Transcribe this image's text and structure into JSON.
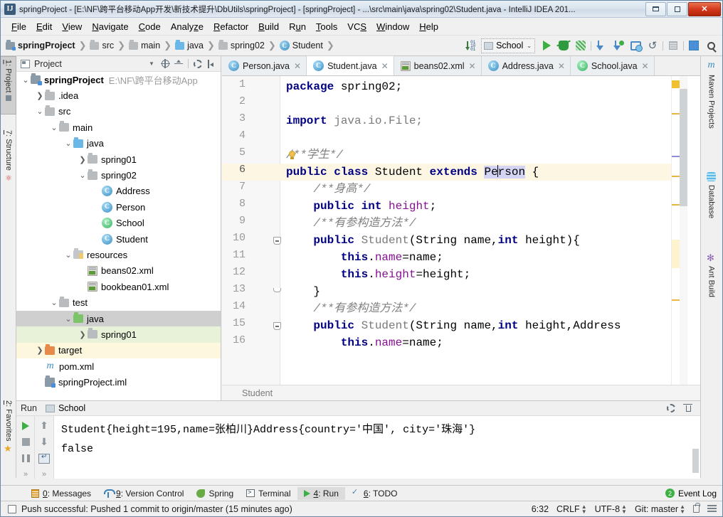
{
  "window": {
    "app_icon": "IJ",
    "title": "springProject - [E:\\NF\\跨平台移动App开发\\新技术提升\\DbUtils\\springProject] - [springProject] - ...\\src\\main\\java\\spring02\\Student.java - IntelliJ IDEA 201...",
    "buttons": {
      "minimize": "minimize-button",
      "maximize": "maximize-button",
      "close": "✕"
    }
  },
  "menubar": {
    "items": [
      {
        "label": "File"
      },
      {
        "label": "Edit"
      },
      {
        "label": "View"
      },
      {
        "label": "Navigate"
      },
      {
        "label": "Code"
      },
      {
        "label": "Analyze"
      },
      {
        "label": "Refactor"
      },
      {
        "label": "Build"
      },
      {
        "label": "Run"
      },
      {
        "label": "Tools"
      },
      {
        "label": "VCS"
      },
      {
        "label": "Window"
      },
      {
        "label": "Help"
      }
    ]
  },
  "navbar": {
    "breadcrumbs": [
      {
        "label": "springProject",
        "icon": "module-icon"
      },
      {
        "label": "src",
        "icon": "folder-icon"
      },
      {
        "label": "main",
        "icon": "folder-icon"
      },
      {
        "label": "java",
        "icon": "source-folder-icon"
      },
      {
        "label": "spring02",
        "icon": "package-icon"
      },
      {
        "label": "Student",
        "icon": "class-icon"
      }
    ],
    "separator": "❯",
    "run_config": "School",
    "run_config_caret": "⌄",
    "toolbar": [
      {
        "name": "sort-by-order-icon",
        "title": "Sort"
      },
      {
        "name": "run-icon",
        "title": "Run"
      },
      {
        "name": "debug-icon",
        "title": "Debug"
      },
      {
        "name": "run-coverage-icon",
        "title": "Run with Coverage"
      },
      {
        "name": "update-project-icon",
        "title": "Update Project"
      },
      {
        "name": "commit-icon",
        "title": "Commit"
      },
      {
        "name": "history-icon",
        "title": "History"
      },
      {
        "name": "rollback-icon",
        "title": "Rollback"
      },
      {
        "name": "settings-stripe-icon",
        "title": "Stripe"
      },
      {
        "name": "structure-icon",
        "title": "Structure"
      },
      {
        "name": "search-everywhere-icon",
        "title": "Search Everywhere"
      }
    ]
  },
  "left_strip": {
    "tabs": [
      {
        "label": "1: Project",
        "num": "1",
        "selected": true,
        "icon": "project-icon"
      },
      {
        "label": "7: Structure",
        "num": "7",
        "selected": false,
        "icon": "structure-icon"
      },
      {
        "label": "2: Favorites",
        "num": "2",
        "selected": false,
        "icon": "star-icon"
      }
    ]
  },
  "project_panel": {
    "title": "Project",
    "tools": [
      {
        "name": "view-options-caret-icon"
      },
      {
        "name": "scroll-to-source-icon"
      },
      {
        "name": "collapse-all-icon"
      },
      {
        "name": "gear-icon"
      },
      {
        "name": "hide-panel-icon"
      }
    ],
    "tree": [
      {
        "indent": 0,
        "chev": "⌄",
        "icon": "module-icon",
        "label": "springProject",
        "bold": true,
        "sub": "E:\\NF\\跨平台移动App",
        "highlight": ""
      },
      {
        "indent": 1,
        "chev": "❯",
        "icon": "folder-icon",
        "label": ".idea",
        "highlight": ""
      },
      {
        "indent": 1,
        "chev": "⌄",
        "icon": "folder-icon",
        "label": "src",
        "highlight": ""
      },
      {
        "indent": 2,
        "chev": "⌄",
        "icon": "folder-icon",
        "label": "main",
        "highlight": ""
      },
      {
        "indent": 3,
        "chev": "⌄",
        "icon": "source-folder-icon",
        "label": "java",
        "highlight": ""
      },
      {
        "indent": 4,
        "chev": "❯",
        "icon": "package-icon",
        "label": "spring01",
        "highlight": ""
      },
      {
        "indent": 4,
        "chev": "⌄",
        "icon": "package-icon",
        "label": "spring02",
        "highlight": ""
      },
      {
        "indent": 5,
        "chev": "",
        "icon": "class-icon",
        "label": "Address",
        "highlight": ""
      },
      {
        "indent": 5,
        "chev": "",
        "icon": "class-icon",
        "label": "Person",
        "highlight": ""
      },
      {
        "indent": 5,
        "chev": "",
        "icon": "class-icon-green",
        "label": "School",
        "highlight": ""
      },
      {
        "indent": 5,
        "chev": "",
        "icon": "class-icon",
        "label": "Student",
        "highlight": ""
      },
      {
        "indent": 3,
        "chev": "⌄",
        "icon": "resources-folder-icon",
        "label": "resources",
        "highlight": ""
      },
      {
        "indent": 4,
        "chev": "",
        "icon": "xml-file-icon",
        "label": "beans02.xml",
        "highlight": ""
      },
      {
        "indent": 4,
        "chev": "",
        "icon": "xml-file-icon",
        "label": "bookbean01.xml",
        "highlight": ""
      },
      {
        "indent": 2,
        "chev": "⌄",
        "icon": "folder-icon",
        "label": "test",
        "highlight": ""
      },
      {
        "indent": 3,
        "chev": "⌄",
        "icon": "test-source-folder-icon",
        "label": "java",
        "highlight": "gray"
      },
      {
        "indent": 4,
        "chev": "❯",
        "icon": "package-icon",
        "label": "spring01",
        "highlight": "green"
      },
      {
        "indent": 1,
        "chev": "❯",
        "icon": "target-folder-icon",
        "label": "target",
        "highlight": "yellow"
      },
      {
        "indent": 1,
        "chev": "",
        "icon": "maven-file-icon",
        "label": "pom.xml",
        "highlight": ""
      },
      {
        "indent": 1,
        "chev": "",
        "icon": "iml-file-icon",
        "label": "springProject.iml",
        "highlight": ""
      }
    ]
  },
  "editor": {
    "tabs": [
      {
        "label": "Person.java",
        "icon": "class-icon",
        "active": false,
        "close": "✕"
      },
      {
        "label": "Student.java",
        "icon": "class-icon",
        "active": true,
        "close": "✕"
      },
      {
        "label": "beans02.xml",
        "icon": "xml-file-icon",
        "active": false,
        "close": "✕"
      },
      {
        "label": "Address.java",
        "icon": "class-icon",
        "active": false,
        "close": "✕"
      },
      {
        "label": "School.java",
        "icon": "class-icon-green",
        "active": false,
        "close": "✕"
      }
    ],
    "breadcrumb": "Student",
    "current_line": 6,
    "caret_position": "6:32",
    "lines": [
      {
        "n": 1,
        "segments": [
          {
            "t": "package",
            "c": "kw"
          },
          {
            "t": " spring02;",
            "c": ""
          }
        ]
      },
      {
        "n": 2,
        "segments": []
      },
      {
        "n": 3,
        "segments": [
          {
            "t": "import",
            "c": "kw"
          },
          {
            "t": " java.io.File;",
            "c": "cls"
          }
        ]
      },
      {
        "n": 4,
        "segments": []
      },
      {
        "n": 5,
        "segments": [
          {
            "t": "/**学生*/",
            "c": "cmt"
          }
        ]
      },
      {
        "n": 6,
        "segments": [
          {
            "t": "public class",
            "c": "kw"
          },
          {
            "t": " Student ",
            "c": ""
          },
          {
            "t": "extends",
            "c": "kw"
          },
          {
            "t": " ",
            "c": ""
          },
          {
            "t": "Person",
            "c": "sel"
          },
          {
            "t": " {",
            "c": ""
          }
        ]
      },
      {
        "n": 7,
        "segments": [
          {
            "t": "    /**身高*/",
            "c": "cmt"
          }
        ]
      },
      {
        "n": 8,
        "segments": [
          {
            "t": "    ",
            "c": ""
          },
          {
            "t": "public int",
            "c": "kw"
          },
          {
            "t": " ",
            "c": ""
          },
          {
            "t": "height",
            "c": "fldv"
          },
          {
            "t": ";",
            "c": ""
          }
        ]
      },
      {
        "n": 9,
        "segments": [
          {
            "t": "    /**有参构造方法*/",
            "c": "cmt"
          }
        ]
      },
      {
        "n": 10,
        "segments": [
          {
            "t": "    ",
            "c": ""
          },
          {
            "t": "public",
            "c": "kw"
          },
          {
            "t": " Student",
            "c": "cls"
          },
          {
            "t": "(String name,",
            "c": ""
          },
          {
            "t": "int",
            "c": "kw"
          },
          {
            "t": " height){",
            "c": ""
          }
        ]
      },
      {
        "n": 11,
        "segments": [
          {
            "t": "        ",
            "c": ""
          },
          {
            "t": "this",
            "c": "kw"
          },
          {
            "t": ".",
            "c": ""
          },
          {
            "t": "name",
            "c": "fldv"
          },
          {
            "t": "=name;",
            "c": ""
          }
        ]
      },
      {
        "n": 12,
        "segments": [
          {
            "t": "        ",
            "c": ""
          },
          {
            "t": "this",
            "c": "kw"
          },
          {
            "t": ".",
            "c": ""
          },
          {
            "t": "height",
            "c": "fldv"
          },
          {
            "t": "=height;",
            "c": ""
          }
        ]
      },
      {
        "n": 13,
        "segments": [
          {
            "t": "    }",
            "c": ""
          }
        ]
      },
      {
        "n": 14,
        "segments": [
          {
            "t": "    /**有参构造方法*/",
            "c": "cmt"
          }
        ]
      },
      {
        "n": 15,
        "segments": [
          {
            "t": "    ",
            "c": ""
          },
          {
            "t": "public",
            "c": "kw"
          },
          {
            "t": " Student",
            "c": "cls"
          },
          {
            "t": "(String name,",
            "c": ""
          },
          {
            "t": "int",
            "c": "kw"
          },
          {
            "t": " height,Address",
            "c": ""
          }
        ]
      },
      {
        "n": 16,
        "segments": [
          {
            "t": "        ",
            "c": ""
          },
          {
            "t": "this",
            "c": "kw"
          },
          {
            "t": ".",
            "c": ""
          },
          {
            "t": "name",
            "c": "fldv"
          },
          {
            "t": "=name;",
            "c": ""
          }
        ]
      }
    ]
  },
  "right_strip": {
    "tabs": [
      {
        "label": "Maven Projects",
        "icon": "maven-icon"
      },
      {
        "label": "Database",
        "icon": "database-icon"
      },
      {
        "label": "Ant Build",
        "icon": "ant-icon"
      }
    ]
  },
  "run_panel": {
    "title": "Run",
    "config": "School",
    "tools": [
      {
        "name": "gear-icon"
      },
      {
        "name": "export-icon"
      }
    ],
    "left_tools": [
      {
        "name": "rerun-icon"
      },
      {
        "name": "stop-icon"
      },
      {
        "name": "pause-icon"
      },
      {
        "name": "expand-more-icon"
      }
    ],
    "left_tools_2": [
      {
        "name": "up-arrow-icon"
      },
      {
        "name": "down-arrow-icon"
      },
      {
        "name": "soft-wrap-icon"
      },
      {
        "name": "expand-more-icon"
      }
    ],
    "console_lines": [
      "Student{height=195,name=张柏川}Address{country='中国', city='珠海'}",
      "false"
    ]
  },
  "bottom_bar": {
    "windows": [
      {
        "label": "0: Messages",
        "num": "0",
        "icon": "messages-icon",
        "active": false
      },
      {
        "label": "9: Version Control",
        "num": "9",
        "icon": "version-control-icon",
        "active": false
      },
      {
        "label": "Spring",
        "num": "",
        "icon": "spring-icon",
        "active": false
      },
      {
        "label": "Terminal",
        "num": "",
        "icon": "terminal-icon",
        "active": false
      },
      {
        "label": "4: Run",
        "num": "4",
        "icon": "run-icon",
        "active": true
      },
      {
        "label": "6: TODO",
        "num": "6",
        "icon": "todo-icon",
        "active": false
      }
    ],
    "event_log": {
      "label": "Event Log",
      "badge": "2",
      "icon": "event-log-icon"
    }
  },
  "status_bar": {
    "message": "Push successful: Pushed 1 commit to origin/master (15 minutes ago)",
    "caret": "6:32",
    "line_sep": "CRLF",
    "encoding": "UTF-8",
    "branch": "Git: master",
    "caret_sub": "⌄",
    "icons": [
      {
        "name": "lock-icon"
      },
      {
        "name": "memory-indicator-icon"
      }
    ]
  },
  "colors": {
    "accent_blue": "#4a90d9",
    "keyword": "#000084",
    "comment": "#808080",
    "field": "#871094",
    "current_line": "#fdf6e3",
    "selection": "#d4d4f5",
    "green_run": "#3cb043"
  }
}
